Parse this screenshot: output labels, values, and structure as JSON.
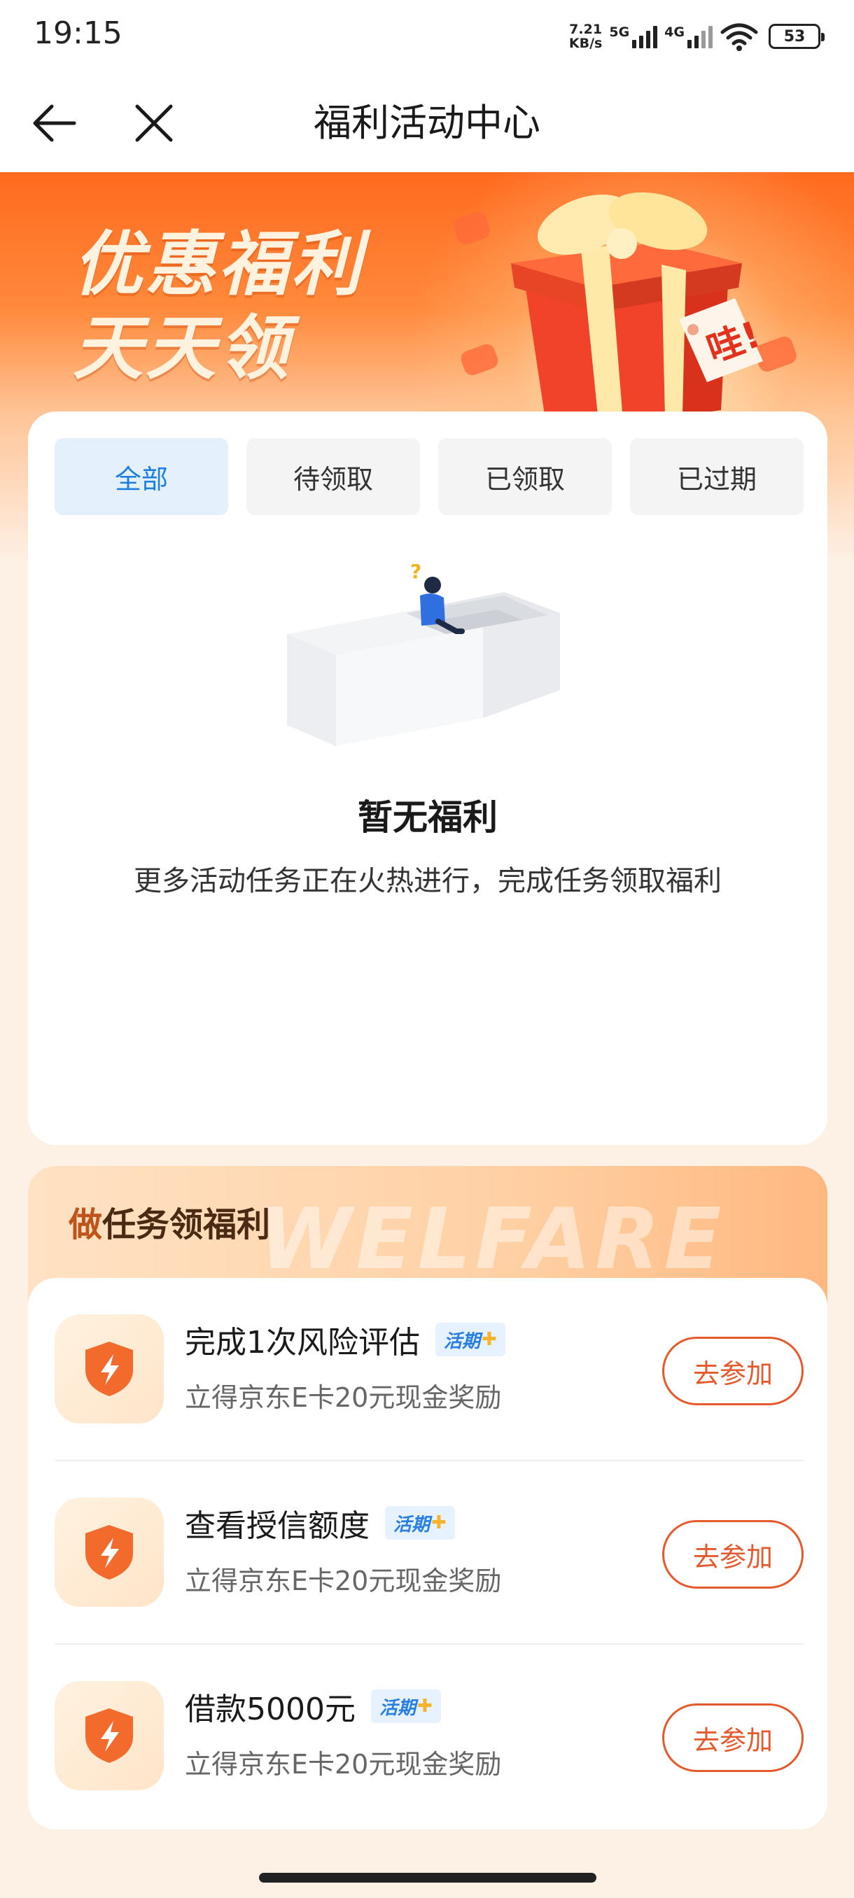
{
  "status_bar": {
    "time": "19:15",
    "net_speed_value": "7.21",
    "net_speed_unit": "KB/s",
    "sig1_label": "5G",
    "sig2_label": "4G",
    "battery": "53"
  },
  "nav": {
    "title": "福利活动中心",
    "back_icon": "arrow-left-icon",
    "close_icon": "close-icon"
  },
  "banner": {
    "line1": "优惠福利",
    "line2": "天天领",
    "tag": "哇!"
  },
  "tabs": [
    {
      "label": "全部",
      "active": true
    },
    {
      "label": "待领取",
      "active": false
    },
    {
      "label": "已领取",
      "active": false
    },
    {
      "label": "已过期",
      "active": false
    }
  ],
  "empty_state": {
    "question_mark": "?",
    "title": "暂无福利",
    "description": "更多活动任务正在火热进行，完成任务领取福利"
  },
  "tasks_section": {
    "title_first": "做",
    "title_rest": "任务领福利",
    "watermark": "WELFARE",
    "items": [
      {
        "name": "完成1次风险评估",
        "badge": "活期",
        "subtitle": "立得京东E卡20元现金奖励",
        "button": "去参加"
      },
      {
        "name": "查看授信额度",
        "badge": "活期",
        "subtitle": "立得京东E卡20元现金奖励",
        "button": "去参加"
      },
      {
        "name": "借款5000元",
        "badge": "活期",
        "subtitle": "立得京东E卡20元现金奖励",
        "button": "去参加"
      }
    ]
  },
  "colors": {
    "accent_orange": "#e45a2c",
    "tab_active_bg": "#e4f1fd",
    "tab_active_text": "#1f7fe0"
  }
}
